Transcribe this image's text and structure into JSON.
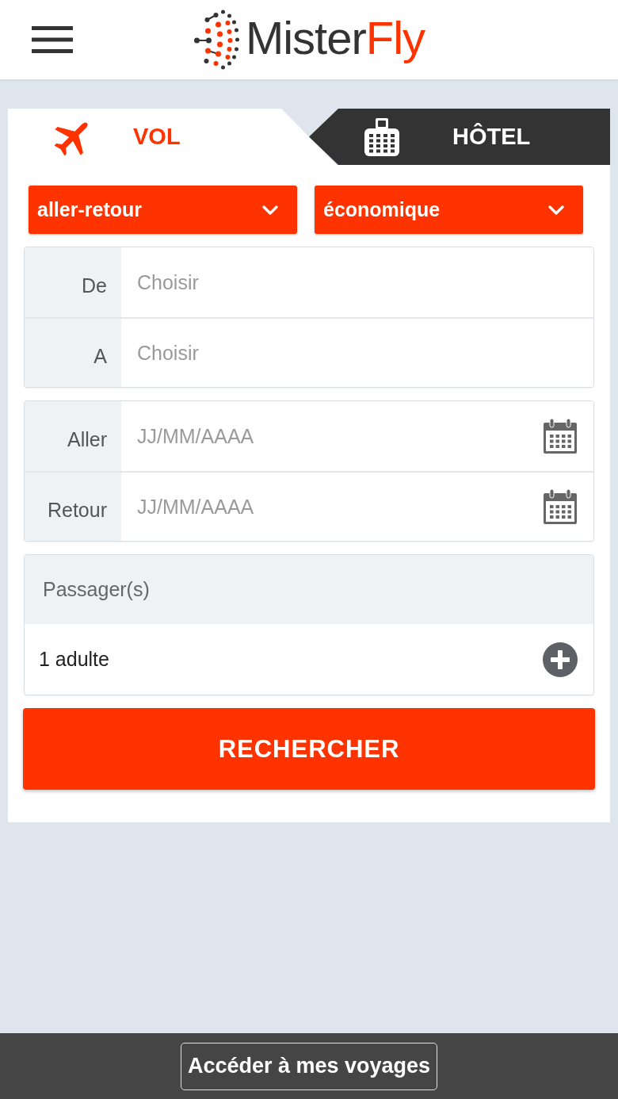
{
  "header": {
    "logo": {
      "text": "Mister",
      "accent": "Fly"
    }
  },
  "tabs": [
    {
      "label": "VOL",
      "kind": "flight",
      "selected": true
    },
    {
      "label": "HÔTEL",
      "kind": "hotel",
      "selected": false
    }
  ],
  "selects": [
    "aller-retour",
    "économique"
  ],
  "field_groups": [
    {
      "fields": [
        {
          "label": "De",
          "placeholder": "Choisir",
          "kind": "text"
        },
        {
          "label": "A",
          "placeholder": "Choisir",
          "kind": "text"
        }
      ]
    },
    {
      "fields": [
        {
          "label": "Aller",
          "placeholder": "JJ/MM/AAAA",
          "kind": "date"
        },
        {
          "label": "Retour",
          "placeholder": "JJ/MM/AAAA",
          "kind": "date"
        }
      ]
    }
  ],
  "passengers": {
    "title": "Passager(s)",
    "value": "1 adulte"
  },
  "search_button": "RECHERCHER",
  "footer": {
    "button": "Accéder à mes voyages"
  }
}
